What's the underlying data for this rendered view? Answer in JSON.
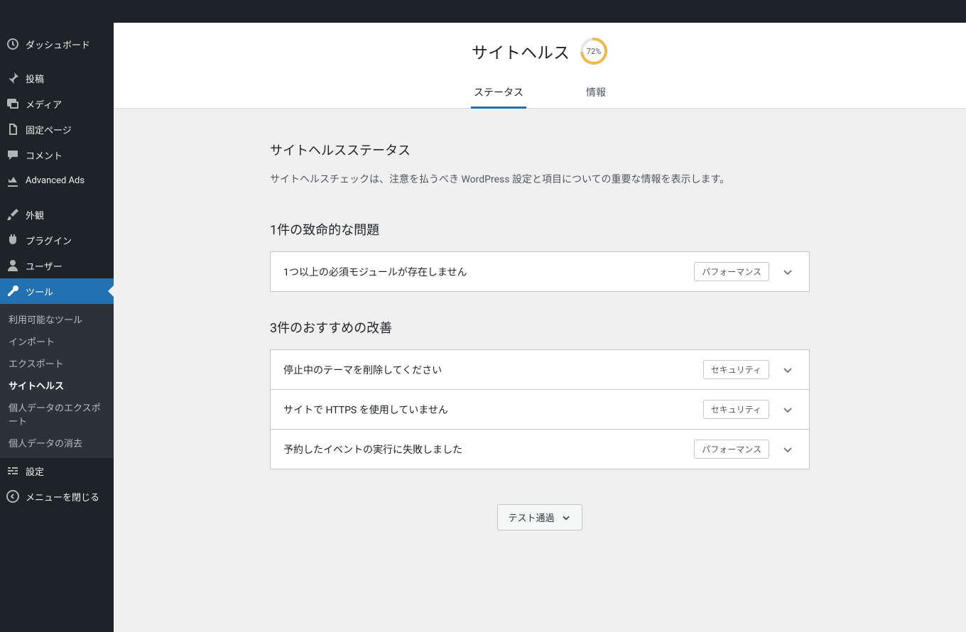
{
  "sidebar": {
    "dashboard": "ダッシュボード",
    "posts": "投稿",
    "media": "メディア",
    "pages": "固定ページ",
    "comments": "コメント",
    "advanced_ads": "Advanced Ads",
    "appearance": "外観",
    "plugins": "プラグイン",
    "users": "ユーザー",
    "tools": "ツール",
    "tools_sub": {
      "available": "利用可能なツール",
      "import": "インポート",
      "export": "エクスポート",
      "site_health": "サイトヘルス",
      "export_personal": "個人データのエクスポート",
      "erase_personal": "個人データの消去"
    },
    "settings": "設定",
    "collapse": "メニューを閉じる"
  },
  "header": {
    "title": "サイトヘルス",
    "percent_text": "72%",
    "percent_value": 72
  },
  "tabs": {
    "status": "ステータス",
    "info": "情報"
  },
  "status": {
    "section_title": "サイトヘルスステータス",
    "section_desc": "サイトヘルスチェックは、注意を払うべき WordPress 設定と項目についての重要な情報を表示します。",
    "critical_heading": "1件の致命的な問題",
    "critical": [
      {
        "title": "1つ以上の必須モジュールが存在しません",
        "badge": "パフォーマンス"
      }
    ],
    "recommended_heading": "3件のおすすめの改善",
    "recommended": [
      {
        "title": "停止中のテーマを削除してください",
        "badge": "セキュリティ"
      },
      {
        "title": "サイトで HTTPS を使用していません",
        "badge": "セキュリティ"
      },
      {
        "title": "予約したイベントの実行に失敗しました",
        "badge": "パフォーマンス"
      }
    ],
    "test_passed": "テスト通過"
  },
  "colors": {
    "accent": "#2271b1",
    "ring": "#f0b849"
  }
}
